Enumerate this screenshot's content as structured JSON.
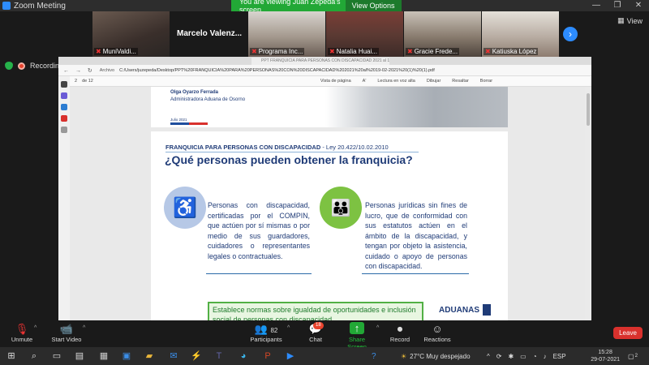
{
  "zoom": {
    "app_title": "Zoom Meeting",
    "share_banner": "You are viewing Juan Zepeda's screen",
    "view_options": "View Options ⌄",
    "view_label": "View",
    "recording_label": "Recording"
  },
  "participants": [
    {
      "name": "MuniValdi..."
    },
    {
      "name": "Marcelo  Valenz..."
    },
    {
      "name": "Programa Inc..."
    },
    {
      "name": "Natalia Huai..."
    },
    {
      "name": "Gracie Frede..."
    },
    {
      "name": "Katiuska López"
    }
  ],
  "browser": {
    "tab_title": "PPT FRANQUICIA PARA PERSONAS CON DISCAPACIDAD 2021 al 19-02-2021 (1) (1).pdf",
    "archivo_label": "Archivo",
    "url": "C:/Users/juzepeda/Desktop/PPT%20FRANQUICIA%20PARA%20PERSONAS%20CON%20DISCAPACIDAD%202021%20al%2019-02-2021%20(1)%20(1).pdf",
    "nav_symbols": "← → ↻"
  },
  "pdf_toolbar": {
    "page_value": "2",
    "page_total": "de 12",
    "items": [
      "Vista de página",
      "A'",
      "Lectura en voz alta",
      "Dibujar",
      "Resaltar",
      "Borrar"
    ]
  },
  "page1": {
    "name": "Olga Oyarzo Ferrada",
    "role": "Administradora Aduana de Osorno",
    "date": "Julio 2021"
  },
  "page2": {
    "subtitle": "FRANQUICIA PARA PERSONAS CON DISCAPACIDAD",
    "law": " - Ley 20.422/10.02.2010",
    "title": "¿Qué personas pueden obtener la franquicia?",
    "left_icon": "wheelchair-icon",
    "right_icon": "people-group-icon",
    "left_text": "Personas con discapacidad, certificadas por el COMPIN, que actúen por sí mismas o por medio de sus guardadores, cuidadores o representantes legales o contractuales.",
    "right_text": "Personas jurídicas sin fines de lucro, que de conformidad con sus estatutos actúen en el ámbito de la discapacidad, y tengan por objeto la asistencia, cuidado o apoyo de personas con discapacidad.",
    "banner_text": "Establece normas sobre igualdad de oportunidades e inclusión social de personas con discapacidad",
    "logo_text": "ADUANAS"
  },
  "controls": {
    "unmute": "Unmute",
    "start_video": "Start Video",
    "participants": "Participants",
    "participants_count": "82",
    "chat": "Chat",
    "chat_badge": "18",
    "share_screen": "Share Screen",
    "record": "Record",
    "reactions": "Reactions",
    "leave": "Leave"
  },
  "taskbar": {
    "weather": "27°C  Muy despejado",
    "language": "ESP",
    "time": "15:28",
    "date": "29-07-2021",
    "notif_count": "2"
  },
  "colors": {
    "zoom_blue": "#2d8cff",
    "share_green": "#22a836",
    "leave_red": "#d9312d",
    "doc_navy": "#1f3b77",
    "banner_green": "#52b045"
  }
}
